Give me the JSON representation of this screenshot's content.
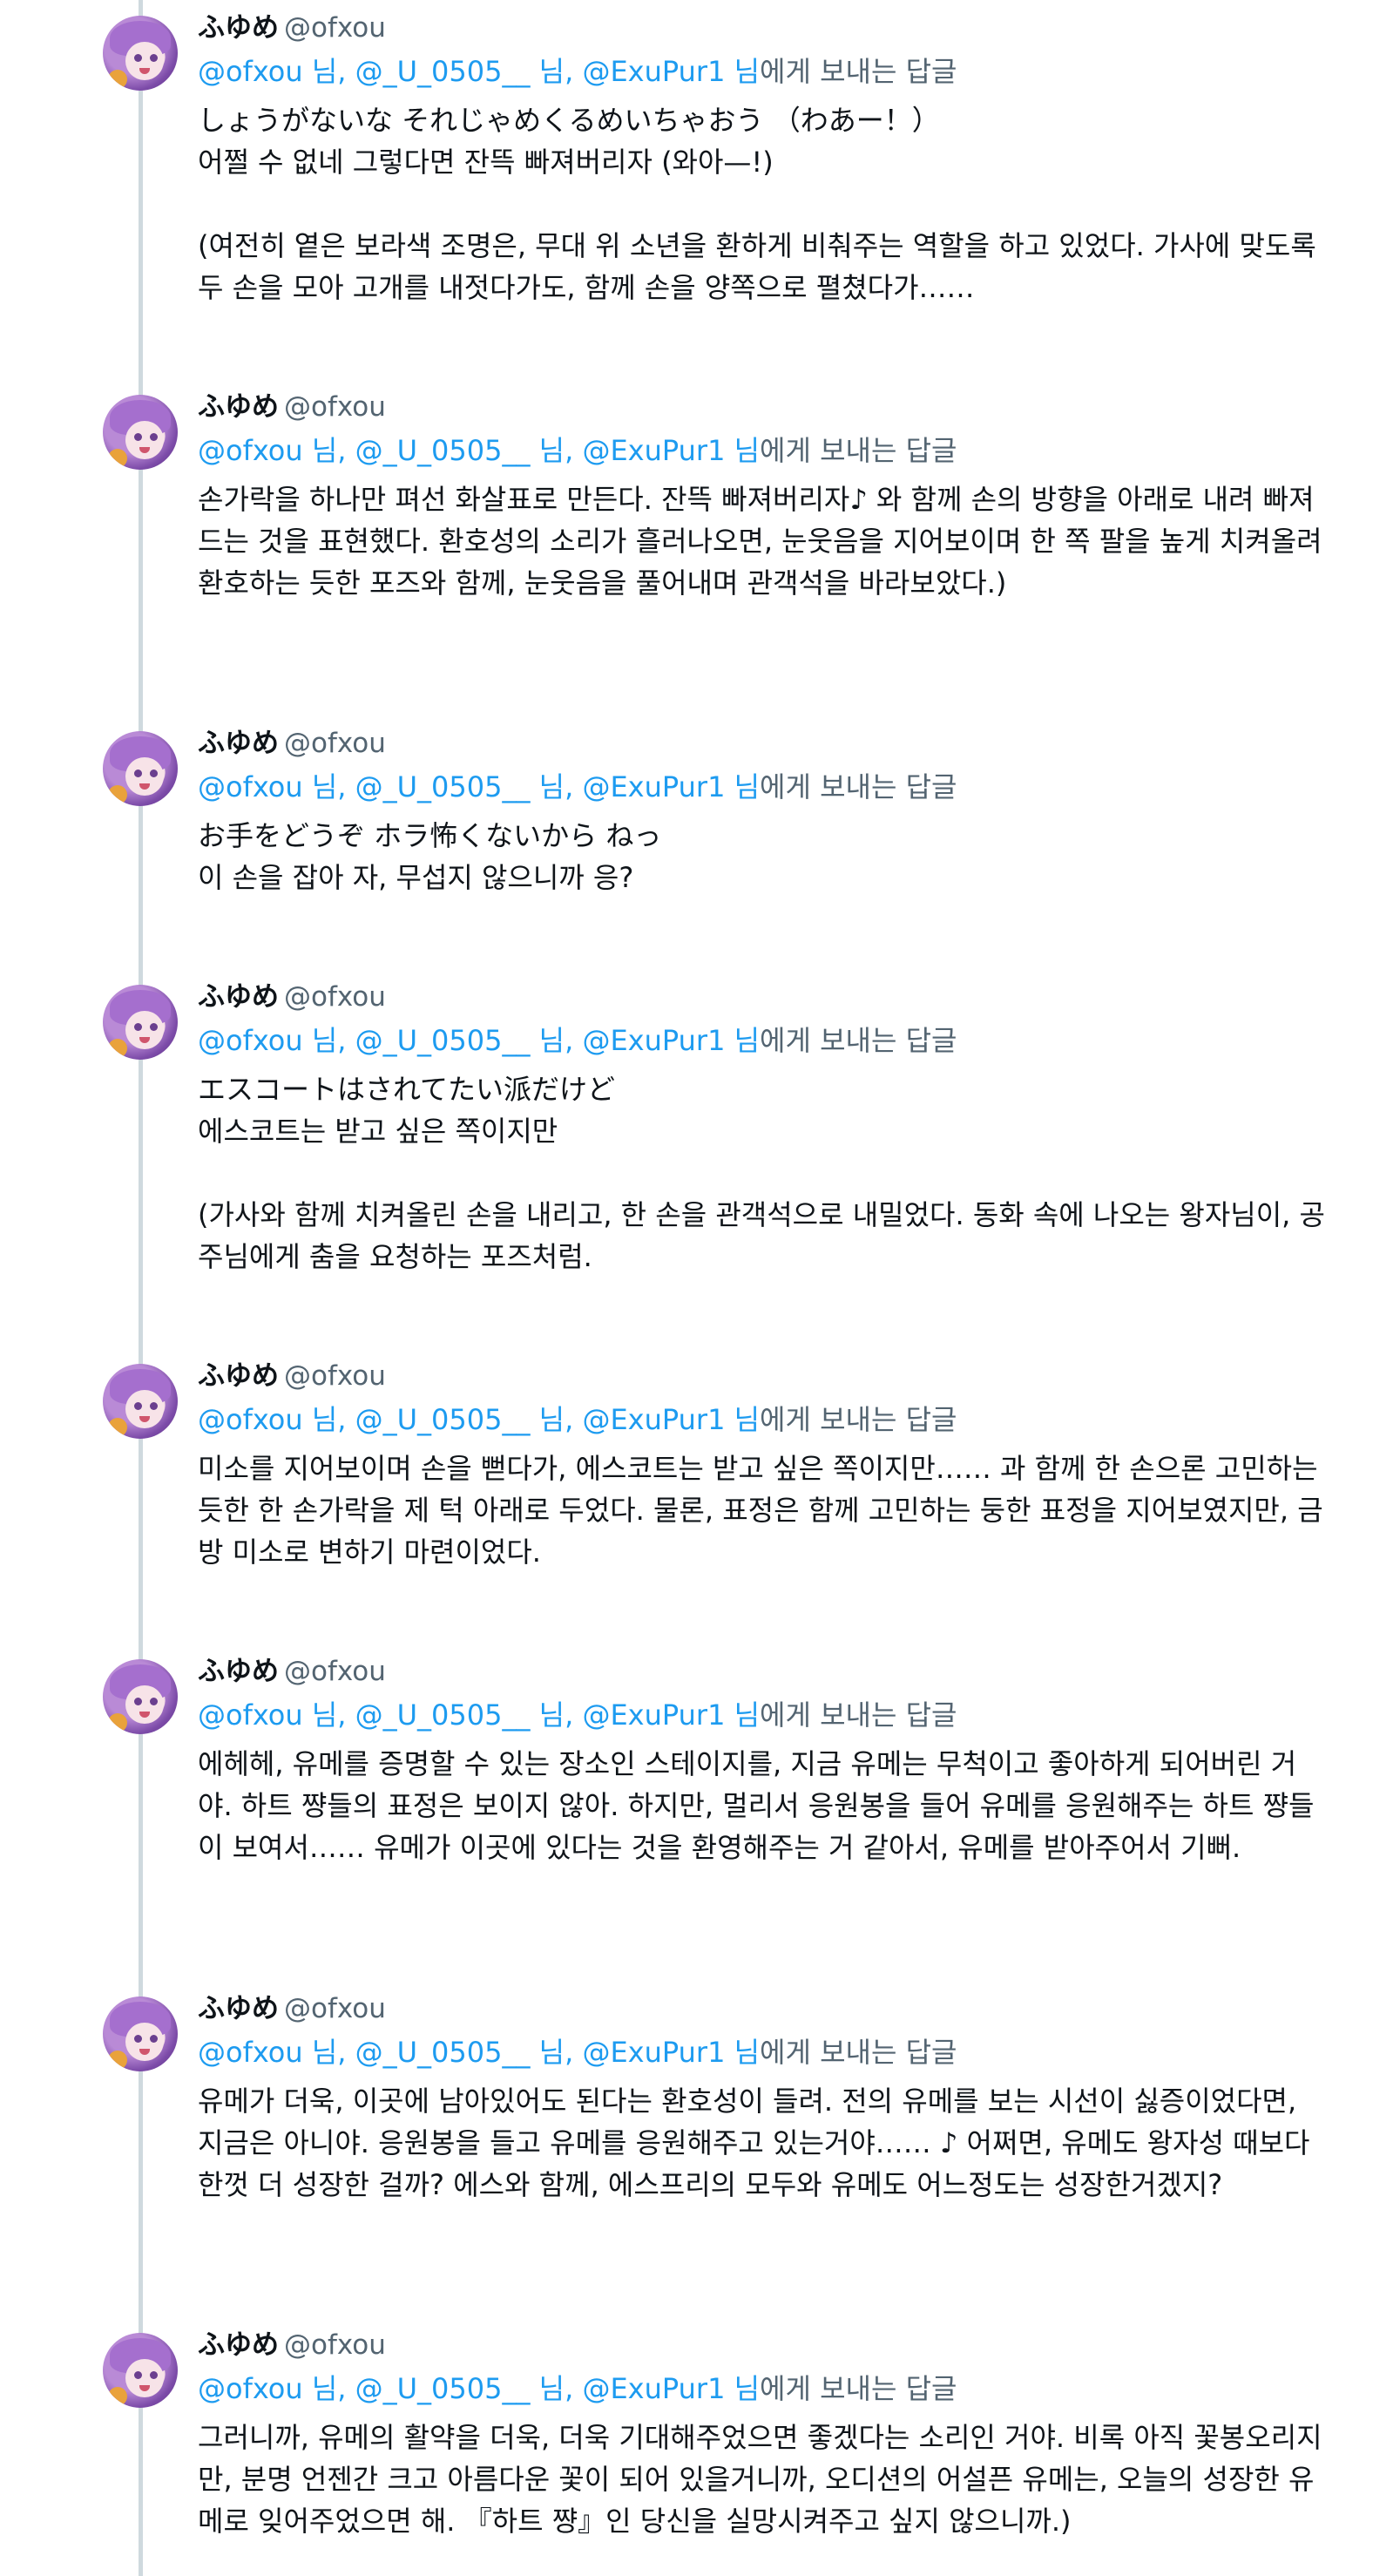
{
  "thread": {
    "reply_prefix_mentions": [
      "@ofxou 님,",
      "@_U_0505__ 님,",
      "@ExuPur1 님"
    ],
    "reply_suffix": "에게 보내는 답글",
    "tweets": [
      {
        "display_name": "ふゆめ",
        "handle": "@ofxou",
        "body": "しょうがないな それじゃめくるめいちゃおう （わあー！）\n어쩔 수 없네 그렇다면 잔뜩 빠져버리자 (와아—!)\n\n(여전히 옅은 보라색 조명은, 무대 위 소년을 환하게 비춰주는 역할을 하고 있었다. 가사에 맞도록 두 손을 모아 고개를 내젓다가도, 함께 손을 양쪽으로 펼쳤다가……"
      },
      {
        "display_name": "ふゆめ",
        "handle": "@ofxou",
        "body": "손가락을 하나만 펴선 화살표로 만든다. 잔뜩 빠져버리자♪ 와 함께 손의 방향을 아래로 내려 빠져드는 것을 표현했다. 환호성의 소리가 흘러나오면, 눈웃음을 지어보이며 한 쪽 팔을 높게 치켜올려 환호하는 듯한 포즈와 함께, 눈웃음을 풀어내며 관객석을 바라보았다.)"
      },
      {
        "display_name": "ふゆめ",
        "handle": "@ofxou",
        "body": "お手をどうぞ ホラ怖くないから ねっ\n이 손을 잡아 자, 무섭지 않으니까 응?"
      },
      {
        "display_name": "ふゆめ",
        "handle": "@ofxou",
        "body": "エスコートはされてたい派だけど\n에스코트는 받고 싶은 쪽이지만\n\n(가사와 함께 치켜올린 손을 내리고, 한 손을 관객석으로 내밀었다. 동화 속에 나오는 왕자님이, 공주님에게 춤을 요청하는 포즈처럼."
      },
      {
        "display_name": "ふゆめ",
        "handle": "@ofxou",
        "body": "미소를 지어보이며 손을 뻗다가, 에스코트는 받고 싶은 쪽이지만…… 과 함께 한 손으론 고민하는 듯한 한 손가락을 제 턱 아래로 두었다. 물론, 표정은 함께 고민하는 둥한 표정을 지어보였지만, 금방 미소로 변하기 마련이었다."
      },
      {
        "display_name": "ふゆめ",
        "handle": "@ofxou",
        "body": "에헤헤, 유메를 증명할 수 있는 장소인 스테이지를, 지금 유메는 무척이고 좋아하게 되어버린 거야. 하트 쨩들의 표정은 보이지 않아. 하지만, 멀리서 응원봉을 들어 유메를 응원해주는 하트 쨩들이 보여서…… 유메가 이곳에 있다는 것을 환영해주는 거 같아서, 유메를 받아주어서 기뻐."
      },
      {
        "display_name": "ふゆめ",
        "handle": "@ofxou",
        "body": "유메가 더욱, 이곳에 남아있어도 된다는 환호성이 들려. 전의 유메를 보는 시선이 싫증이었다면, 지금은 아니야. 응원봉을 들고 유메를 응원해주고 있는거야…… ♪ 어쩌면, 유메도 왕자성 때보다 한껏 더 성장한 걸까? 에스와 함께, 에스프리의 모두와 유메도 어느정도는 성장한거겠지?"
      },
      {
        "display_name": "ふゆめ",
        "handle": "@ofxou",
        "body": "그러니까, 유메의 활약을 더욱, 더욱 기대해주었으면 좋겠다는 소리인 거야. 비록 아직 꽃봉오리지만, 분명 언젠간 크고 아름다운 꽃이 되어 있을거니까, 오디션의 어설픈 유메는, 오늘의 성장한 유메로 잊어주었으면 해. 『하트 쨩』인 당신을 실망시켜주고 싶지 않으니까.)"
      }
    ]
  }
}
